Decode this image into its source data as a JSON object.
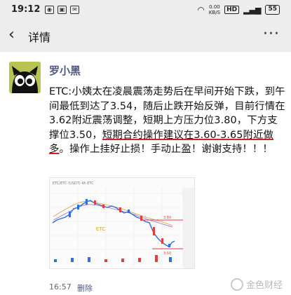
{
  "status_bar": {
    "time": "19:12",
    "speed_value": "0.00",
    "speed_unit": "KB/S",
    "hd": "HD",
    "battery": "55"
  },
  "nav": {
    "back_icon": "chevron-left-icon",
    "title": "详情",
    "more_icon": "more-dots-icon"
  },
  "post": {
    "author": "罗小黑",
    "text_before": "ETC:小姨太在凌晨震荡走势后在早间开始下跌，到午间最低到达了3.54，随后止跌开始反弹，目前行情在3.62附近震荡调整，短期上方压力位3.80，下方支撑位3.50，",
    "text_underlined": "短期合约操作建议在3.60-3.65附近做多",
    "text_after": "。操作上挂好止损！手动止盈！谢谢支持！！！",
    "time": "16:57",
    "delete_label": "删除"
  },
  "thumbnail": {
    "header_text": "ETC/ETC (USDT) 4h ETC",
    "coin_label": "ETC",
    "upper_level": "3.80",
    "lower_level": "3.50",
    "colors": {
      "up": "#2a6fdb",
      "down": "#e0413c",
      "grid": "#e6e6e6",
      "ma": "#d9a12d"
    }
  },
  "watermark": {
    "text": "金色财经"
  }
}
